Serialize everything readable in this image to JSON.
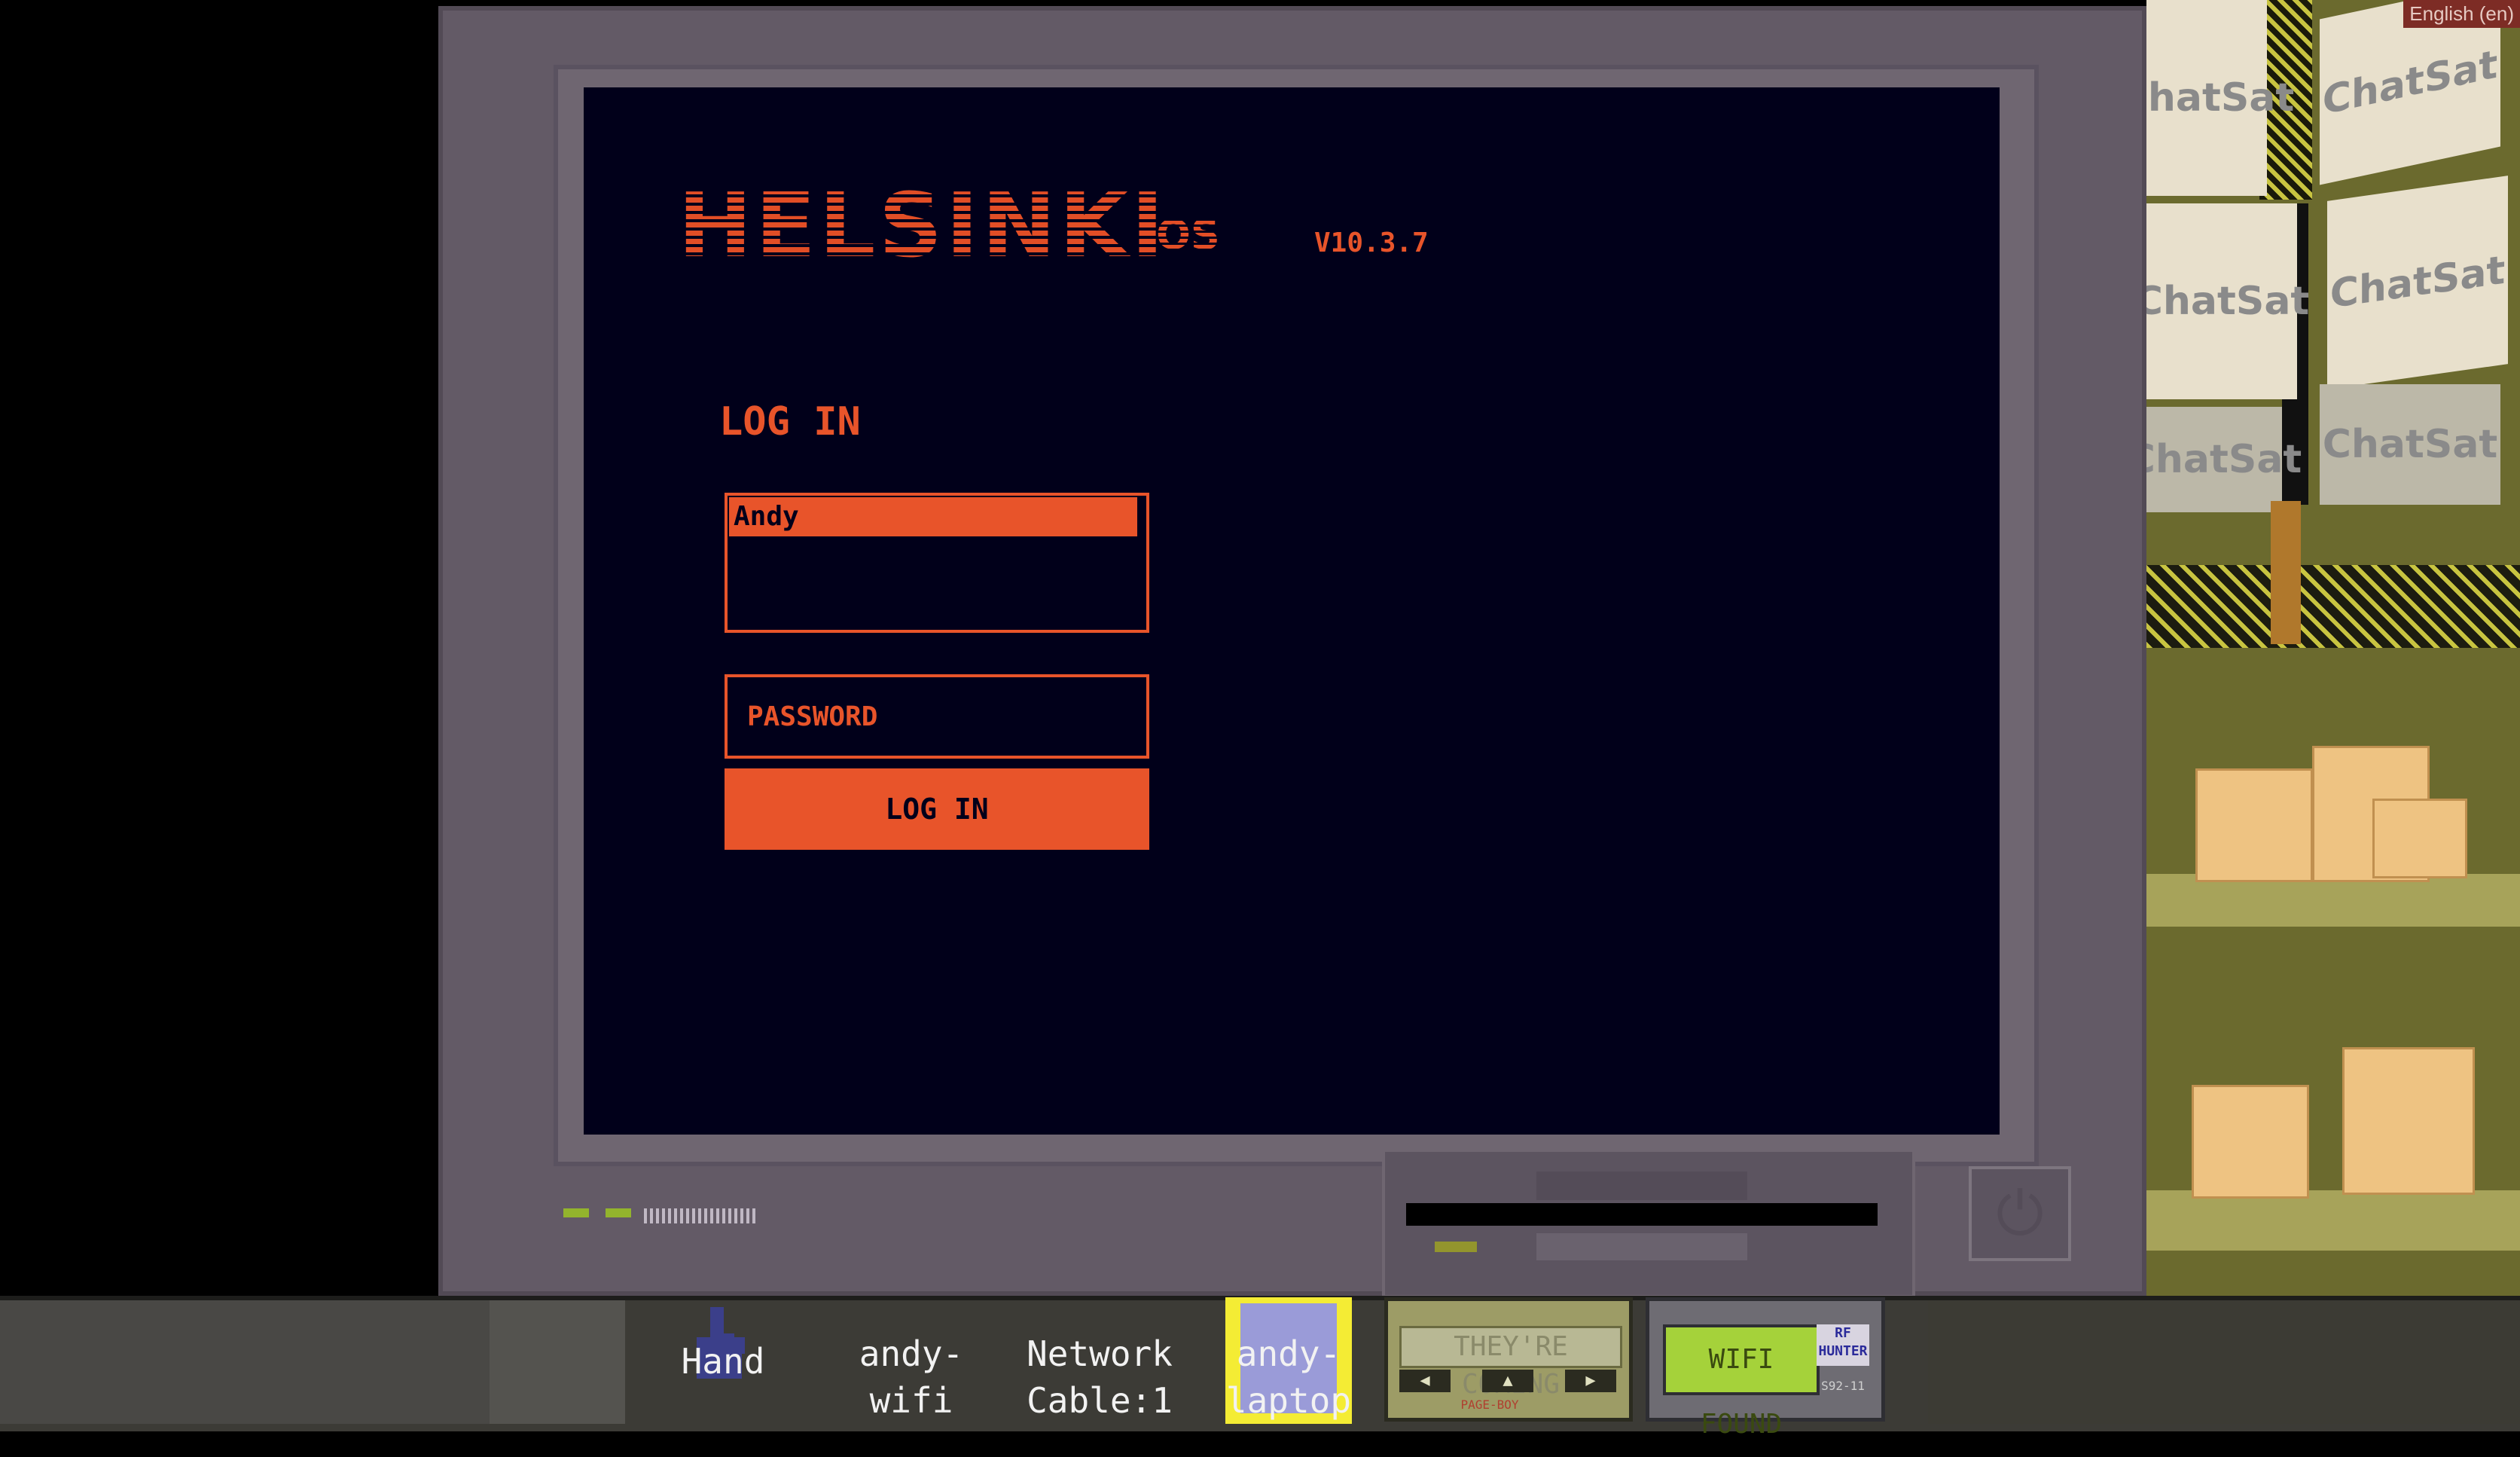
{
  "os": {
    "logo": "HELSINKI",
    "logo_suffix": "OS",
    "version": "V10.3.7"
  },
  "login": {
    "title": "LOG IN",
    "users": [
      "Andy"
    ],
    "password_placeholder": "PASSWORD",
    "button_label": "LOG IN"
  },
  "language": "English (en)",
  "scenery": {
    "sign_text": "ChatSat"
  },
  "taskbar": {
    "items": [
      {
        "label": "Hand"
      },
      {
        "label": "andy-\nwifi"
      },
      {
        "label": "Network\nCable:1"
      },
      {
        "label": "andy-\nlaptop"
      }
    ],
    "pager": {
      "message": "THEY'RE COMING",
      "brand": "PAGE-BOY"
    },
    "rf_hunter": {
      "display": "WIFI FOUND",
      "logo": "RF\nHUNTER",
      "model": "S92-11"
    }
  },
  "colors": {
    "accent": "#e8542a",
    "screen_bg": "#01001a",
    "monitor": "#635a66",
    "language_badge": "#7d2c25"
  }
}
